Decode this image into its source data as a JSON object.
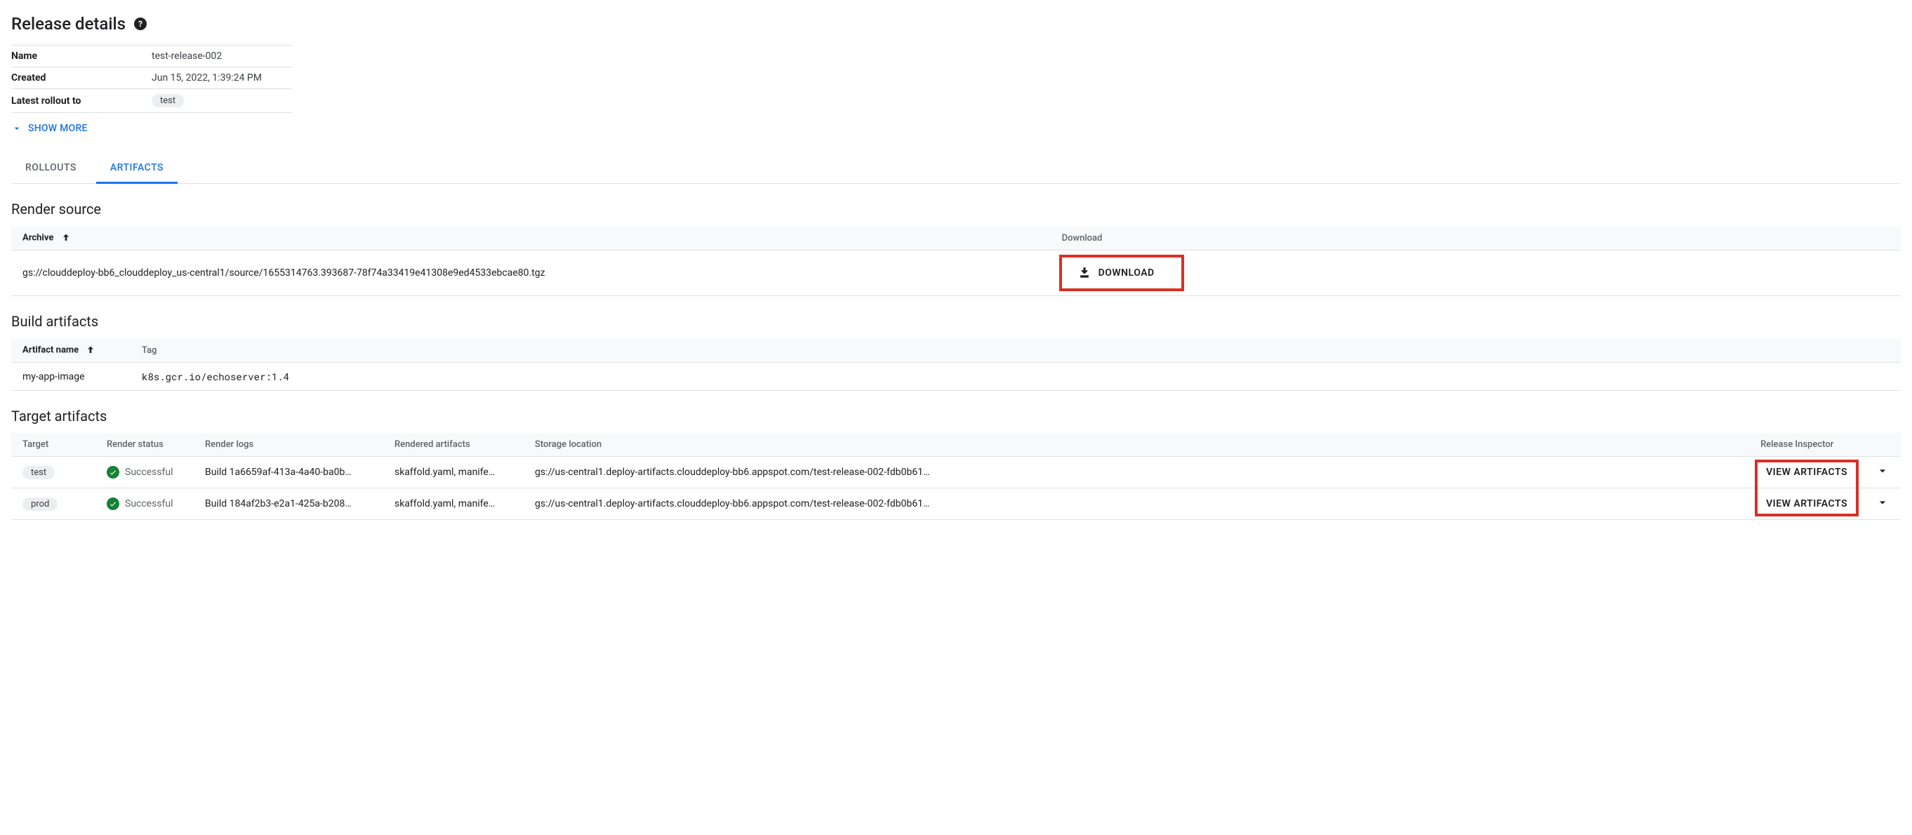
{
  "page": {
    "title": "Release details"
  },
  "details": {
    "rows": [
      {
        "key": "Name",
        "value": "test-release-002",
        "chip": false
      },
      {
        "key": "Created",
        "value": "Jun 15, 2022, 1:39:24 PM",
        "chip": false
      },
      {
        "key": "Latest rollout to",
        "value": "test",
        "chip": true
      }
    ],
    "show_more_label": "SHOW MORE"
  },
  "tabs": {
    "rollouts": "ROLLOUTS",
    "artifacts": "ARTIFACTS"
  },
  "render_source": {
    "title": "Render source",
    "columns": {
      "archive": "Archive",
      "download": "Download"
    },
    "row": {
      "archive": "gs://clouddeploy-bb6_clouddeploy_us-central1/source/1655314763.393687-78f74a33419e41308e9ed4533ebcae80.tgz",
      "download_label": "DOWNLOAD"
    }
  },
  "build_artifacts": {
    "title": "Build artifacts",
    "columns": {
      "name": "Artifact name",
      "tag": "Tag"
    },
    "row": {
      "name": "my-app-image",
      "tag": "k8s.gcr.io/echoserver:1.4"
    }
  },
  "target_artifacts": {
    "title": "Target artifacts",
    "columns": {
      "target": "Target",
      "render_status": "Render status",
      "render_logs": "Render logs",
      "rendered_artifacts": "Rendered artifacts",
      "storage_location": "Storage location",
      "release_inspector": "Release Inspector"
    },
    "rows": [
      {
        "target": "test",
        "render_status": "Successful",
        "render_logs": "Build 1a6659af-413a-4a40-ba0b…",
        "rendered_artifacts": "skaffold.yaml, manife…",
        "storage_location": "gs://us-central1.deploy-artifacts.clouddeploy-bb6.appspot.com/test-release-002-fdb0b61…",
        "view_label": "VIEW ARTIFACTS"
      },
      {
        "target": "prod",
        "render_status": "Successful",
        "render_logs": "Build 184af2b3-e2a1-425a-b208…",
        "rendered_artifacts": "skaffold.yaml, manife…",
        "storage_location": "gs://us-central1.deploy-artifacts.clouddeploy-bb6.appspot.com/test-release-002-fdb0b61…",
        "view_label": "VIEW ARTIFACTS"
      }
    ]
  }
}
